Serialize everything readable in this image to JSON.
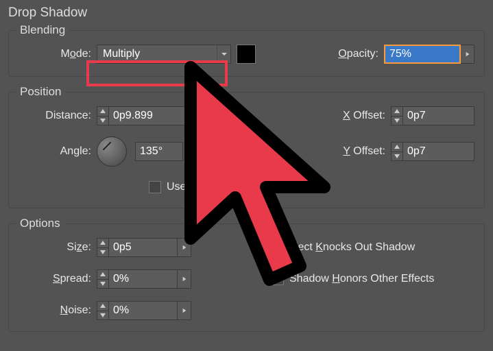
{
  "title": "Drop Shadow",
  "blending": {
    "legend": "Blending",
    "mode_label_pre": "M",
    "mode_label_underline": "o",
    "mode_label_post": "de:",
    "mode_value": "Multiply",
    "opacity_label_underline": "O",
    "opacity_label_post": "pacity:",
    "opacity_value": "75%",
    "swatch_color": "#000000"
  },
  "position": {
    "legend": "Position",
    "distance_label": "Distance:",
    "distance_value": "0p9.899",
    "angle_label": "Angle:",
    "angle_value": "135°",
    "xoffset_label_underline": "X",
    "xoffset_label_post": " Offset:",
    "xoffset_value": "0p7",
    "yoffset_label_underline": "Y",
    "yoffset_label_post": " Offset:",
    "yoffset_value": "0p7",
    "use_global_label": "Use"
  },
  "options": {
    "legend": "Options",
    "size_label_post": "Si",
    "size_label_underline": "z",
    "size_label_post2": "e:",
    "size_value": "0p5",
    "spread_label_underline": "S",
    "spread_label_post": "pread:",
    "spread_value": "0%",
    "noise_label_underline": "N",
    "noise_label_post": "oise:",
    "noise_value": "0%",
    "knockout_label_pre": "bject ",
    "knockout_label_underline": "K",
    "knockout_label_post": "nocks Out Shadow",
    "honors_label_pre": "Shadow ",
    "honors_label_underline": "H",
    "honors_label_post": "onors Other Effects"
  }
}
